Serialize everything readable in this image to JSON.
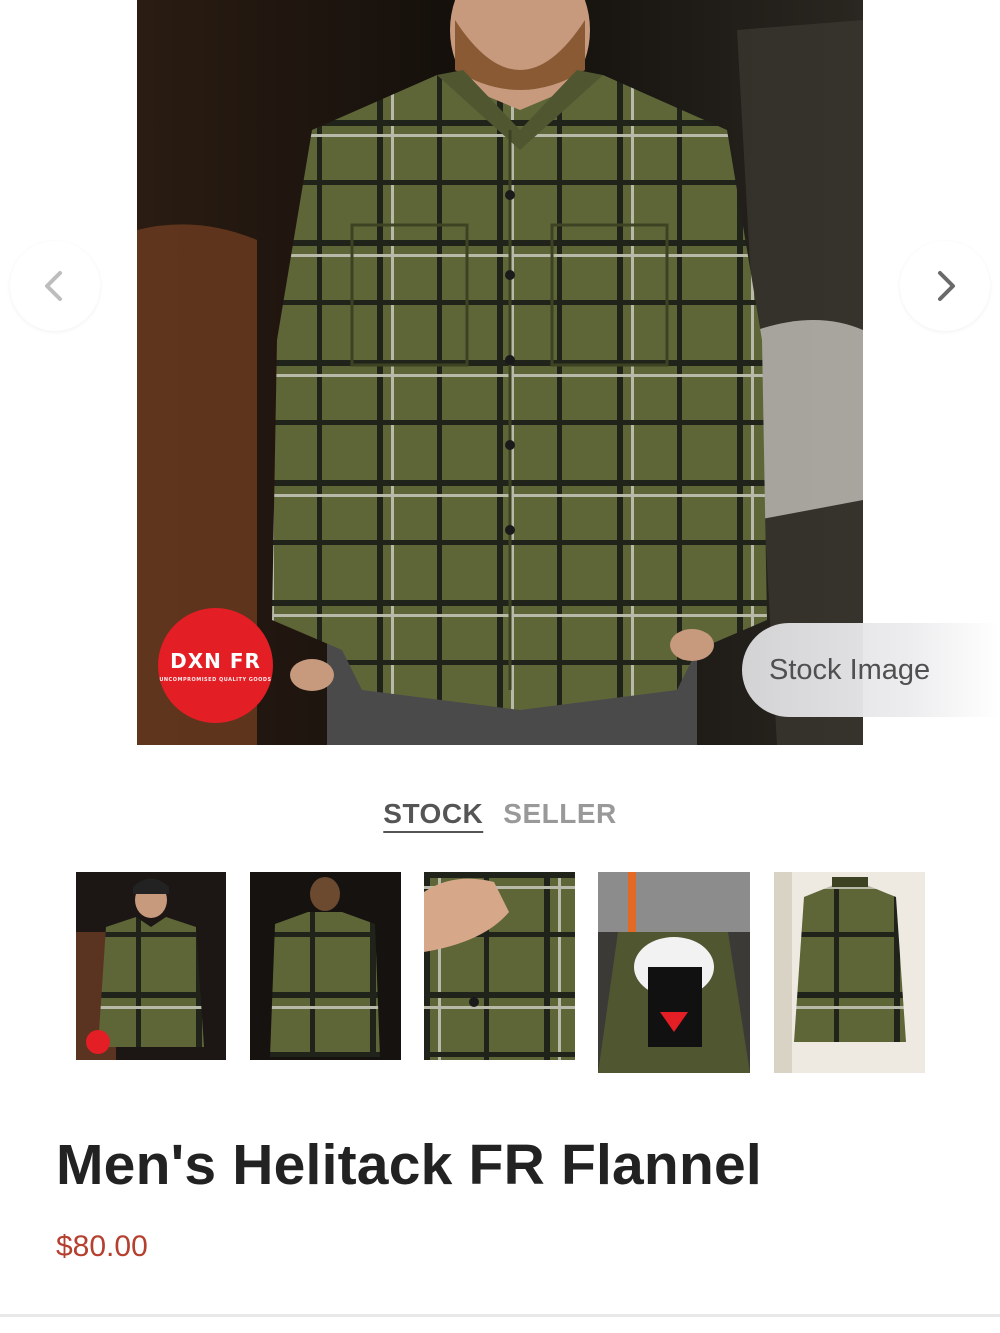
{
  "hero": {
    "overlay_label": "Stock Image",
    "brand_badge": {
      "text": "DXN FR",
      "subtext": "UNCOMPROMISED QUALITY GOODS"
    },
    "prev_icon": "chevron-left-icon",
    "next_icon": "chevron-right-icon"
  },
  "tabs": [
    {
      "label": "STOCK",
      "active": true
    },
    {
      "label": "SELLER",
      "active": false
    }
  ],
  "thumbnails": [
    {
      "name": "front-model"
    },
    {
      "name": "back-model"
    },
    {
      "name": "collar-detail"
    },
    {
      "name": "tag-closeup"
    },
    {
      "name": "hanging-shirt"
    }
  ],
  "product": {
    "title": "Men's Helitack FR Flannel",
    "price": "$80.00"
  },
  "colors": {
    "price": "#b5402f",
    "badge": "#e41e25",
    "shirt": "#5e6638"
  }
}
